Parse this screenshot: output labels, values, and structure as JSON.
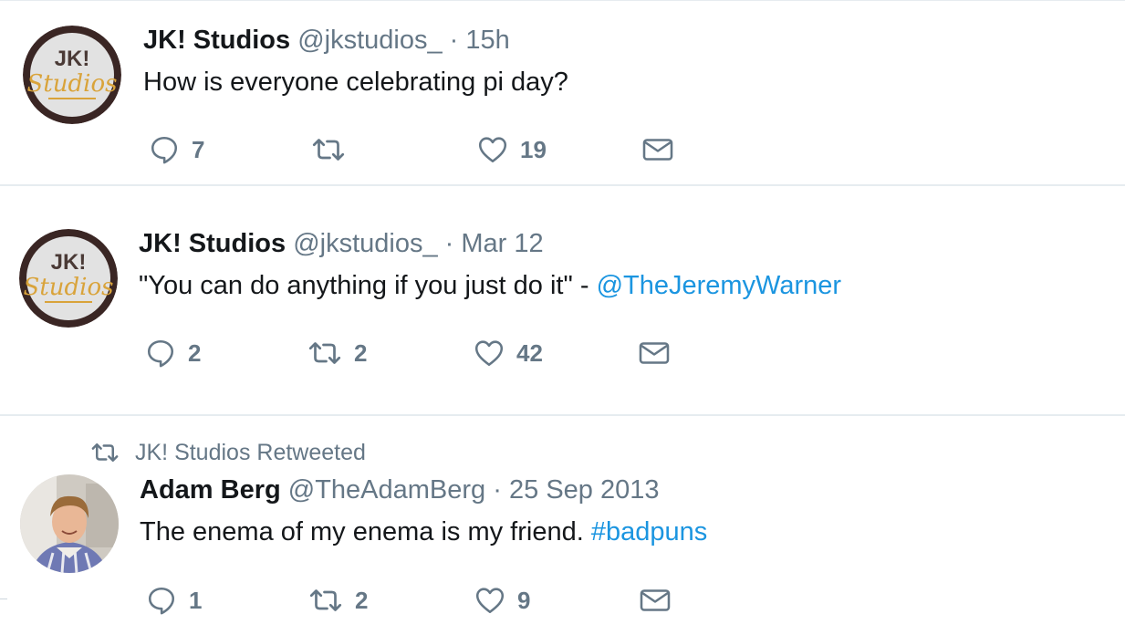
{
  "tweets": [
    {
      "author_name": "JK! Studios",
      "handle": "@jkstudios_",
      "separator": "·",
      "time": "15h",
      "text": "How is everyone celebrating pi day?",
      "replies": "7",
      "retweets": "",
      "likes": "19"
    },
    {
      "author_name": "JK! Studios",
      "handle": "@jkstudios_",
      "separator": "·",
      "time": "Mar 12",
      "text": "\"You can do anything if you just do it\" - ",
      "mention": "@TheJeremyWarner",
      "replies": "2",
      "retweets": "2",
      "likes": "42"
    },
    {
      "context": "JK! Studios Retweeted",
      "author_name": "Adam Berg",
      "handle": "@TheAdamBerg",
      "separator": "·",
      "time": "25 Sep 2013",
      "text": "The enema of my enema is my friend. ",
      "hashtag": "#badpuns",
      "replies": "1",
      "retweets": "2",
      "likes": "9"
    }
  ],
  "avatars": {
    "jk_logo_lines": [
      "JK!",
      "Studios"
    ],
    "jk_colors": {
      "ring": "#3a2624",
      "plate": "#e2e2e2",
      "lettering": "#d9a33a"
    }
  },
  "colors": {
    "text": "#14171a",
    "secondary": "#657786",
    "link": "#1b95e0",
    "divider": "#e6ecf0"
  },
  "icons": [
    "reply-icon",
    "retweet-icon",
    "like-icon",
    "direct-message-icon"
  ]
}
